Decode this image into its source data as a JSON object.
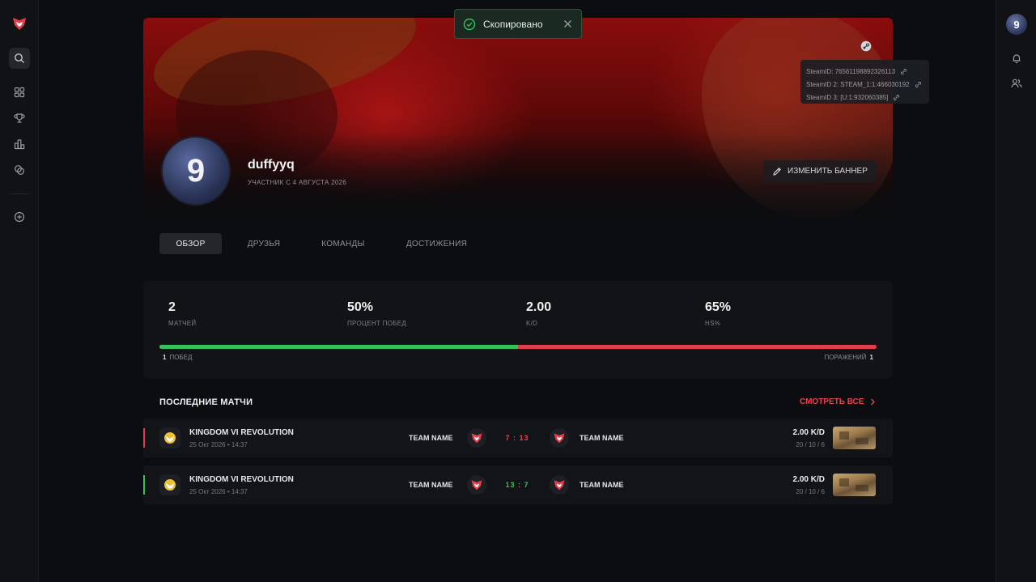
{
  "toast": {
    "text": "Скопировано"
  },
  "steam_ids": [
    {
      "label": "SteamID: 76561198892326113"
    },
    {
      "label": "SteamID 2: STEAM_1:1:466030192"
    },
    {
      "label": "SteamID 3: [U:1:932060385]"
    }
  ],
  "profile": {
    "avatar_glyph": "9",
    "username": "duffyyq",
    "member_since": "УЧАСТНИК С 4 АВГУСТА 2026",
    "change_banner_label": "ИЗМЕНИТЬ БАННЕР"
  },
  "tabs": [
    {
      "label": "ОБЗОР",
      "active": true
    },
    {
      "label": "ДРУЗЬЯ",
      "active": false
    },
    {
      "label": "КОМАНДЫ",
      "active": false
    },
    {
      "label": "ДОСТИЖЕНИЯ",
      "active": false
    }
  ],
  "stats": [
    {
      "value": "2",
      "label": "МАТЧЕЙ"
    },
    {
      "value": "50%",
      "label": "ПРОЦЕНТ ПОБЕД"
    },
    {
      "value": "2.00",
      "label": "K/D"
    },
    {
      "value": "65%",
      "label": "HS%"
    }
  ],
  "win_loss": {
    "wins": "1",
    "wins_label": "ПОБЕД",
    "losses": "1",
    "losses_label": "ПОРАЖЕНИЙ",
    "win_fraction": 0.5,
    "win_color": "#32c35b",
    "loss_color": "#e23e4a"
  },
  "recent": {
    "title": "ПОСЛЕДНИЕ МАТЧИ",
    "view_all": "СМОТРЕТЬ ВСЕ",
    "matches": [
      {
        "tournament": "KINGDOM VI REVOLUTION",
        "date": "25 Окт 2026 • 14:37",
        "team_a": "TEAM NAME",
        "score": "7 : 13",
        "team_b": "TEAM NAME",
        "kd": "2.00 K/D",
        "kda": "20 / 10 / 6",
        "result": "loss",
        "score_color": "#e5434d",
        "accent_color": "#e23e4a"
      },
      {
        "tournament": "KINGDOM VI REVOLUTION",
        "date": "25 Окт 2026 • 14:37",
        "team_a": "TEAM NAME",
        "score": "13 : 7",
        "team_b": "TEAM NAME",
        "kd": "2.00 K/D",
        "kda": "20 / 10 / 6",
        "result": "win",
        "score_color": "#32c35b",
        "accent_color": "#32c35b"
      }
    ]
  },
  "colors": {
    "brand": "#e23e4a",
    "background": "#0c0d10"
  }
}
